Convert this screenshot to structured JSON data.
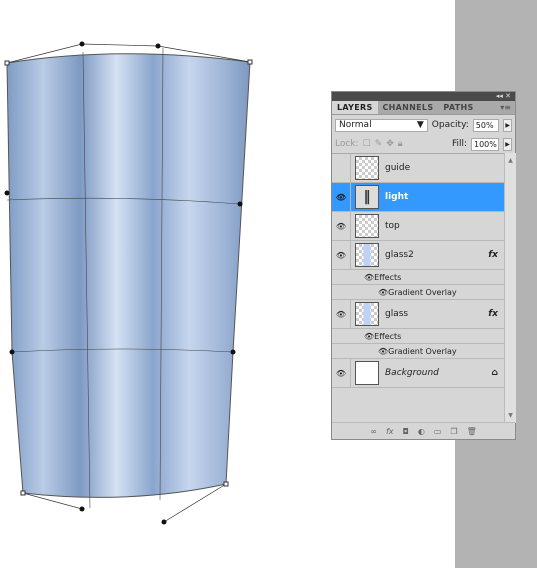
{
  "panel": {
    "tabs": [
      "LAYERS",
      "CHANNELS",
      "PATHS"
    ],
    "blend_mode": "Normal",
    "opacity_label": "Opacity:",
    "opacity": "50%",
    "lock_label": "Lock:",
    "fill_label": "Fill:",
    "fill": "100%",
    "layers": [
      {
        "name": "guide",
        "visible": false
      },
      {
        "name": "light",
        "visible": true,
        "selected": true
      },
      {
        "name": "top",
        "visible": true
      },
      {
        "name": "glass2",
        "visible": true,
        "fx": "fx",
        "effects_label": "Effects",
        "effect": "Gradient Overlay"
      },
      {
        "name": "glass",
        "visible": true,
        "fx": "fx",
        "effects_label": "Effects",
        "effect": "Gradient Overlay"
      },
      {
        "name": "Background",
        "visible": true,
        "locked": true
      }
    ]
  },
  "colors": {
    "selection": "#3399ff",
    "glass": "#8fa9cc"
  }
}
